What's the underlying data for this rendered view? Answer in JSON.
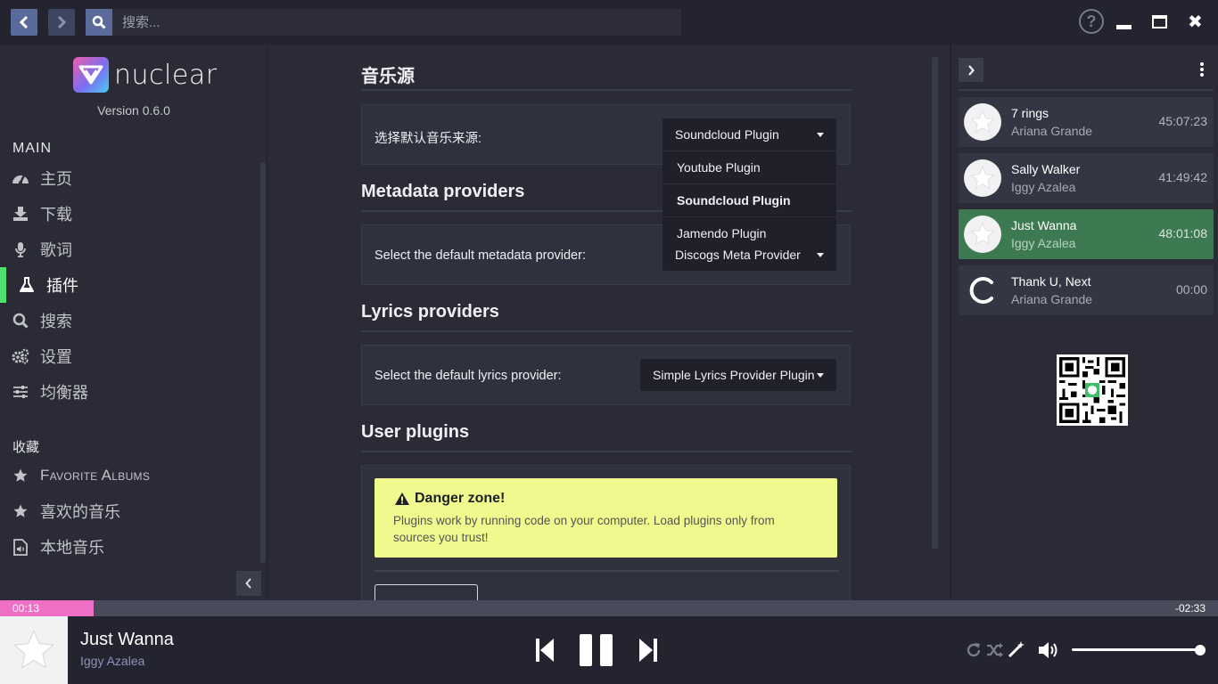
{
  "search": {
    "placeholder": "搜索..."
  },
  "app": {
    "name": "nuclear",
    "version": "Version 0.6.0"
  },
  "sidebar": {
    "main_label": "MAIN",
    "items": [
      {
        "label": "主页",
        "icon": "dashboard-icon"
      },
      {
        "label": "下载",
        "icon": "download-icon"
      },
      {
        "label": "歌词",
        "icon": "microphone-icon"
      },
      {
        "label": "插件",
        "icon": "flask-icon",
        "active": true
      },
      {
        "label": "搜索",
        "icon": "search-icon"
      },
      {
        "label": "设置",
        "icon": "cogs-icon"
      },
      {
        "label": "均衡器",
        "icon": "sliders-icon"
      }
    ],
    "collection_label": "收藏",
    "collection_items": [
      {
        "label": "Favorite Albums",
        "icon": "star-icon"
      },
      {
        "label": "喜欢的音乐",
        "icon": "star-icon"
      },
      {
        "label": "本地音乐",
        "icon": "file-audio-icon"
      }
    ]
  },
  "plugins": {
    "music_sources": {
      "title": "音乐源",
      "label": "选择默认音乐来源:",
      "selected": "Soundcloud Plugin",
      "options": [
        "Youtube Plugin",
        "Soundcloud Plugin",
        "Jamendo Plugin"
      ]
    },
    "metadata": {
      "title": "Metadata providers",
      "label": "Select the default metadata provider:",
      "selected": "Discogs Meta Provider"
    },
    "lyrics": {
      "title": "Lyrics providers",
      "label": "Select the default lyrics provider:",
      "selected": "Simple Lyrics Provider Plugin"
    },
    "user_plugins": {
      "title": "User plugins",
      "danger_title": "Danger zone!",
      "danger_text": "Plugins work by running code on your computer. Load plugins only from sources you trust!"
    }
  },
  "queue": [
    {
      "title": "7 rings",
      "artist": "Ariana Grande",
      "time": "45:07:23",
      "current": false,
      "loading": false
    },
    {
      "title": "Sally Walker",
      "artist": "Iggy Azalea",
      "time": "41:49:42",
      "current": false,
      "loading": false
    },
    {
      "title": "Just Wanna",
      "artist": "Iggy Azalea",
      "time": "48:01:08",
      "current": true,
      "loading": false
    },
    {
      "title": "Thank U, Next",
      "artist": "Ariana Grande",
      "time": "00:00",
      "current": false,
      "loading": true
    }
  ],
  "seek": {
    "elapsed": "00:13",
    "remaining": "-02:33",
    "progress": 0.077
  },
  "now_playing": {
    "title": "Just Wanna",
    "artist": "Iggy Azalea"
  },
  "volume": {
    "level": 1.0
  },
  "colors": {
    "accent_green": "#4fe072",
    "seek_pink": "#ef6fc6",
    "danger_yellow": "#eff98e",
    "current_track": "#3d7a52"
  }
}
